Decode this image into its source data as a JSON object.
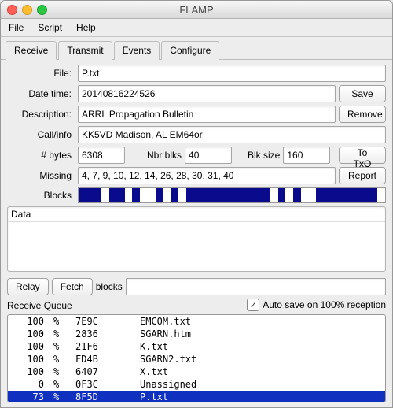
{
  "title": "FLAMP",
  "menu": {
    "file": "File",
    "script": "Script",
    "help": "Help"
  },
  "tabs": {
    "receive": "Receive",
    "transmit": "Transmit",
    "events": "Events",
    "configure": "Configure"
  },
  "labels": {
    "file": "File:",
    "datetime": "Date time:",
    "description": "Description:",
    "callinfo": "Call/info",
    "bytes": "# bytes",
    "nbrblks": "Nbr blks",
    "blksize": "Blk size",
    "missing": "Missing",
    "blocks": "Blocks",
    "data": "Data",
    "blocks2": "blocks",
    "autosave": "Auto save on 100% reception",
    "rqueue": "Receive Queue"
  },
  "buttons": {
    "save": "Save",
    "remove": "Remove",
    "totxq": "To TxQ",
    "report": "Report",
    "relay": "Relay",
    "fetch": "Fetch"
  },
  "fields": {
    "file": "P.txt",
    "datetime": "20140816224526",
    "description": "ARRL Propagation Bulletin",
    "callinfo": "KK5VD Madison, AL EM64or",
    "bytes": "6308",
    "nbrblks": "40",
    "blksize": "160",
    "missing": "4, 7, 9, 10, 12, 14, 26, 28, 30, 31, 40",
    "blocks_text": ""
  },
  "autosave_checked": true,
  "blocks": {
    "total": 40,
    "missing": [
      4,
      7,
      9,
      10,
      12,
      14,
      26,
      28,
      30,
      31,
      40
    ]
  },
  "queue": [
    {
      "pct": "100",
      "unit": "%",
      "id": "7E9C",
      "name": "EMCOM.txt",
      "selected": false
    },
    {
      "pct": "100",
      "unit": "%",
      "id": "2836",
      "name": "SGARN.htm",
      "selected": false
    },
    {
      "pct": "100",
      "unit": "%",
      "id": "21F6",
      "name": "K.txt",
      "selected": false
    },
    {
      "pct": "100",
      "unit": "%",
      "id": "FD4B",
      "name": "SGARN2.txt",
      "selected": false
    },
    {
      "pct": "100",
      "unit": "%",
      "id": "6407",
      "name": "X.txt",
      "selected": false
    },
    {
      "pct": "0",
      "unit": "%",
      "id": "0F3C",
      "name": "Unassigned",
      "selected": false
    },
    {
      "pct": "73",
      "unit": "%",
      "id": "8F5D",
      "name": "P.txt",
      "selected": true
    }
  ]
}
